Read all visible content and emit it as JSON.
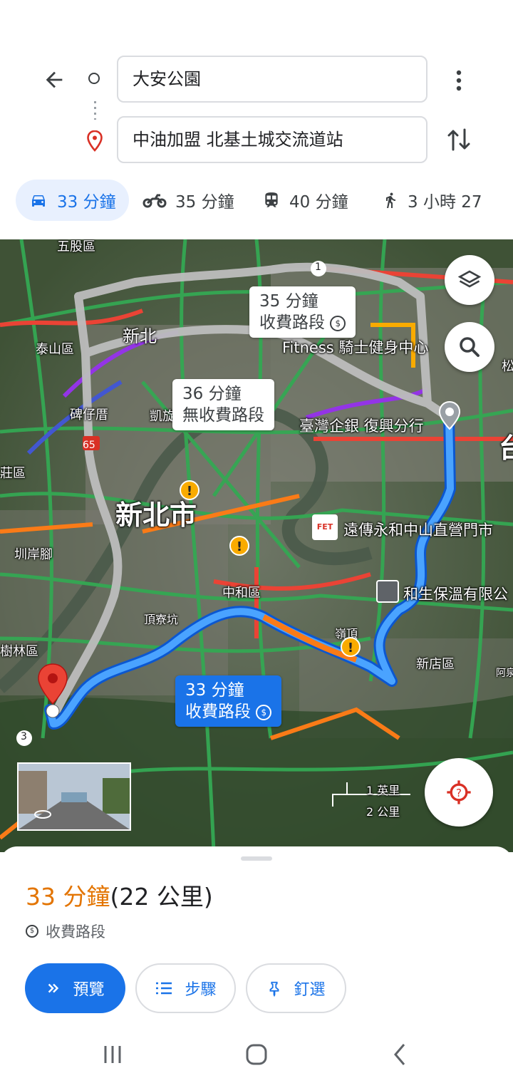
{
  "header": {
    "origin": "大安公園",
    "destination": "中油加盟 北基土城交流道站"
  },
  "modes": [
    {
      "icon": "car-icon",
      "label": "33 分鐘"
    },
    {
      "icon": "motorcycle-icon",
      "label": "35 分鐘"
    },
    {
      "icon": "transit-icon",
      "label": "40 分鐘"
    },
    {
      "icon": "walk-icon",
      "label": "3 小時 27"
    }
  ],
  "map": {
    "callouts": {
      "alt1_time": "35 分鐘",
      "alt1_note": "收費路段",
      "alt2_time": "36 分鐘",
      "alt2_note": "無收費路段",
      "main_time": "33 分鐘",
      "main_note": "收費路段"
    },
    "labels": {
      "wugu": "五股區",
      "xinbei": "新北",
      "taishan": "泰山區",
      "fitness": "Fitness 騎士健身中心",
      "bizaitou": "碑仔厝",
      "kaixuan": "凱旋",
      "tbank": "臺灣企銀 復興分行",
      "tai": "台",
      "zhuang": "莊區",
      "xinbeishi": "新北市",
      "fet": "遠傳永和中山直營門市",
      "tianlan": "圳岸腳",
      "zhonghe": "中和區",
      "hesheng": "和生保溫有限公",
      "dingliao": "頂寮坑",
      "lingding": "嶺頂",
      "xindian": "新店區",
      "shulin": "樹林區",
      "song": "松",
      "afan": "阿泉",
      "route65": "65",
      "route1": "1",
      "route3": "3",
      "fet_logo": "FET"
    },
    "scale": {
      "miles": "1 英里",
      "km": "2 公里"
    }
  },
  "sheet": {
    "eta_time": "33 分鐘",
    "eta_distance": "(22 公里)",
    "toll_note": "收費路段",
    "buttons": {
      "preview": "預覽",
      "steps": "步驟",
      "pin": "釘選"
    }
  },
  "colors": {
    "accent": "#1a73e8",
    "eta": "#e37400",
    "route_alt": "#bdbdbd"
  }
}
